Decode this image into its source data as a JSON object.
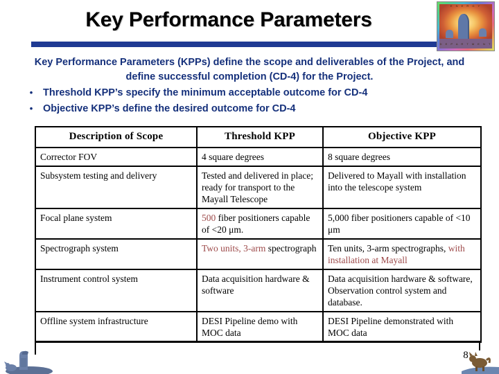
{
  "slide": {
    "title": "Key Performance Parameters",
    "page_number": "8",
    "accent_color": "#1f3a93",
    "body_text_color": "#15307b",
    "highlight_color": "#9d4a4a"
  },
  "logo": {
    "name": "doe-office-of-science-logo",
    "band_top_text": "E N E R G Y",
    "band_bottom_text": "D E P A R T M E N T"
  },
  "body": {
    "intro": "Key Performance Parameters (KPPs) define the scope and deliverables of the Project, and define successful completion (CD-4) for the Project.",
    "bullet_marker": "•",
    "bullets": [
      "Threshold KPP’s specify the minimum acceptable outcome for CD-4",
      "Objective KPP’s define the desired outcome for CD-4"
    ]
  },
  "table": {
    "headers": [
      "Description of Scope",
      "Threshold KPP",
      "Objective KPP"
    ],
    "rows": [
      {
        "scope": "Corrector FOV",
        "threshold": "4 square degrees",
        "objective": "8 square degrees"
      },
      {
        "scope": "Subsystem testing and delivery",
        "threshold": "Tested and delivered in place; ready for transport to the Mayall Telescope",
        "objective": "Delivered to Mayall with installation into the telescope system"
      },
      {
        "scope": "Focal plane system",
        "threshold_parts": [
          {
            "text": "500",
            "highlight": true
          },
          {
            "text": " fiber positioners capable of  <20 μm.",
            "highlight": false
          }
        ],
        "objective": "5,000 fiber positioners capable of <10 μm"
      },
      {
        "scope": "Spectrograph system",
        "threshold_parts": [
          {
            "text": "Two units, 3-arm",
            "highlight": true
          },
          {
            "text": " spectrograph",
            "highlight": false
          }
        ],
        "objective_parts": [
          {
            "text": "Ten units, 3-arm spectrographs, ",
            "highlight": false
          },
          {
            "text": "with installation at Mayall",
            "highlight": true
          }
        ]
      },
      {
        "scope": "Instrument control system",
        "threshold": "Data acquisition hardware & software",
        "objective": "Data acquisition hardware & software, Observation control system and database."
      },
      {
        "scope": "Offline system infrastructure",
        "threshold": "DESI Pipeline demo with MOC data",
        "objective": "DESI Pipeline demonstrated with MOC data"
      }
    ]
  }
}
